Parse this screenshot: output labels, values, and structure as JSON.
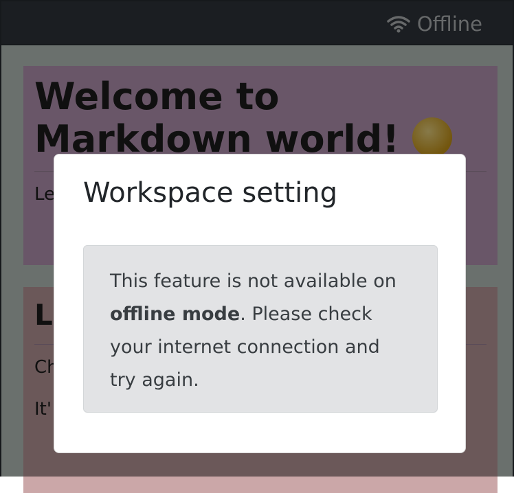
{
  "topbar": {
    "status_icon": "wifi-icon",
    "status_label": "Offline"
  },
  "background": {
    "card1": {
      "heading_line1": "Welcome to",
      "heading_line2": "Markdown world!",
      "emoji": "star-struck-emoji",
      "body_start": "Le"
    },
    "card2": {
      "heading_start": "L",
      "line1_start": "Ch",
      "line2_start": "It'"
    }
  },
  "modal": {
    "title": "Workspace setting",
    "message_before": "This feature is not available on ",
    "message_bold": "offline mode",
    "message_after": ". Please check your internet connection and try again."
  }
}
